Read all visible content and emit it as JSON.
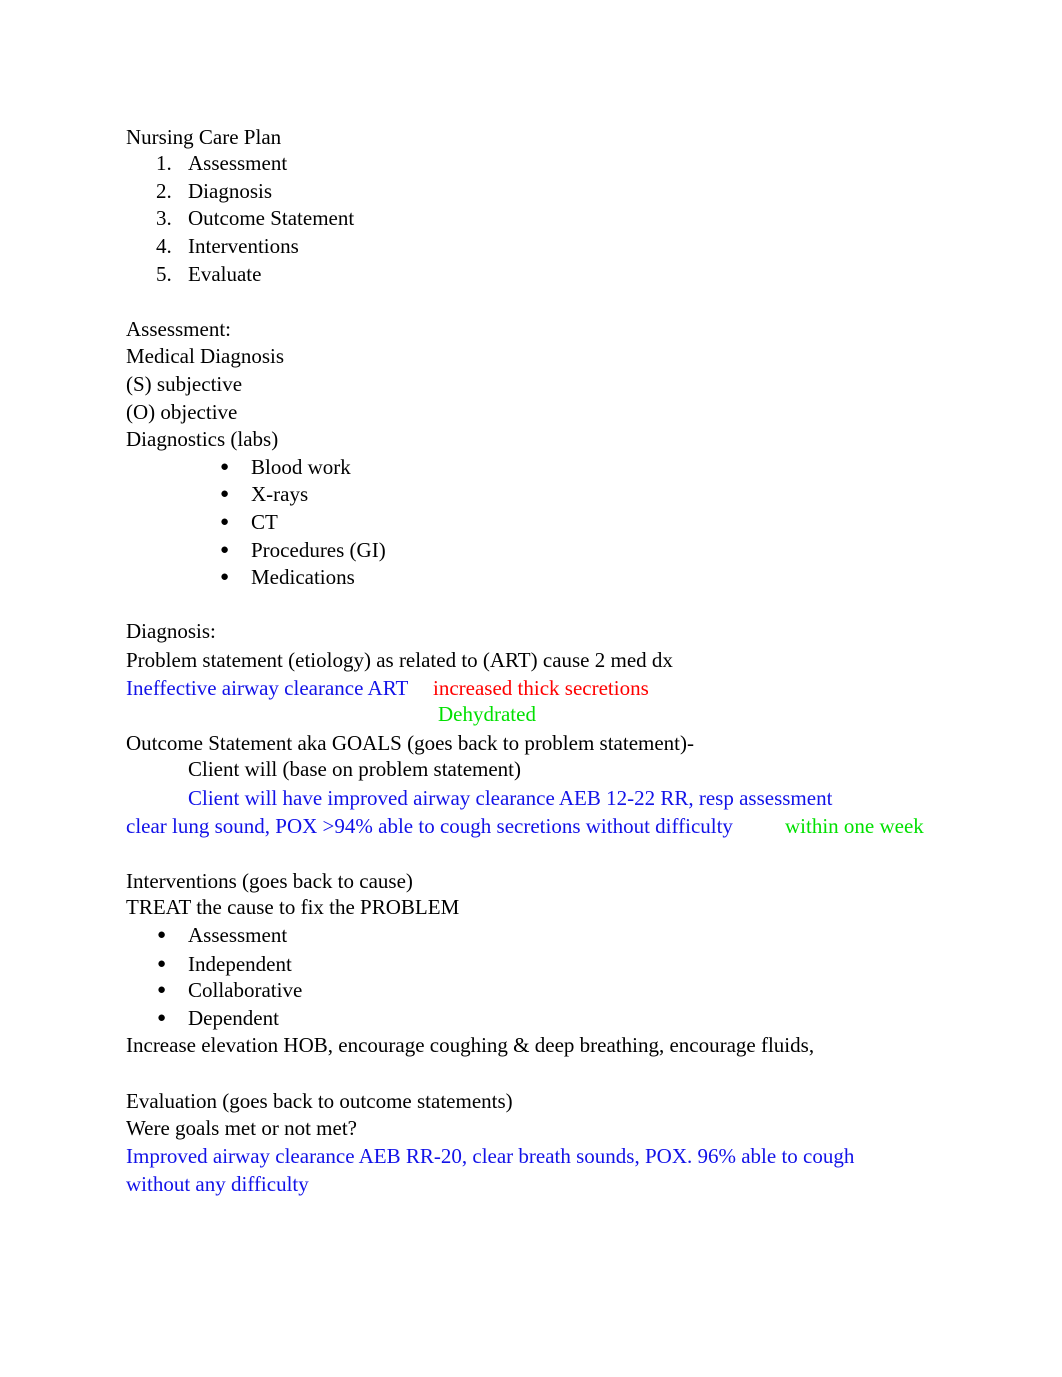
{
  "title": "Nursing Care Plan",
  "steps": [
    "Assessment",
    "Diagnosis",
    "Outcome Statement",
    "Interventions",
    "Evaluate"
  ],
  "assessment": {
    "heading": "Assessment:",
    "lines": [
      "Medical Diagnosis",
      "(S) subjective",
      "(O) objective",
      "Diagnostics (labs)"
    ],
    "diagnostics": [
      "Blood work",
      "X-rays",
      "CT",
      "Procedures (GI)",
      "Medications"
    ]
  },
  "diagnosis": {
    "heading": "Diagnosis:",
    "line1": "Problem statement (etiology) as related to (ART) cause 2 med dx",
    "problem": "Ineffective airway clearance ART",
    "cause1": "increased thick secretions",
    "cause2": "Dehydrated"
  },
  "outcome": {
    "heading": "Outcome Statement aka GOALS (goes back to problem statement)-",
    "line1": "Client will (base on problem statement)",
    "goal_line1": "Client will have improved airway clearance AEB 12-22 RR, resp assessment",
    "goal_line2": "clear lung sound, POX >94% able to cough secretions without difficulty",
    "timeframe": "within one week"
  },
  "interventions": {
    "heading": "Interventions (goes back to cause)",
    "line1": "TREAT the cause to fix the PROBLEM",
    "types": [
      "Assessment",
      "Independent",
      "Collaborative",
      "Dependent"
    ],
    "actions": "Increase elevation HOB, encourage coughing & deep breathing, encourage fluids,"
  },
  "evaluation": {
    "heading": "Evaluation (goes back to outcome statements)",
    "line1": "Were goals met or not met?",
    "result_line1": "Improved airway clearance AEB RR-20, clear breath sounds, POX. 96% able to cough",
    "result_line2": "without any difficulty"
  },
  "colors": {
    "problem": "#1212e8",
    "cause": "#ff0000",
    "secondary": "#00e000"
  }
}
